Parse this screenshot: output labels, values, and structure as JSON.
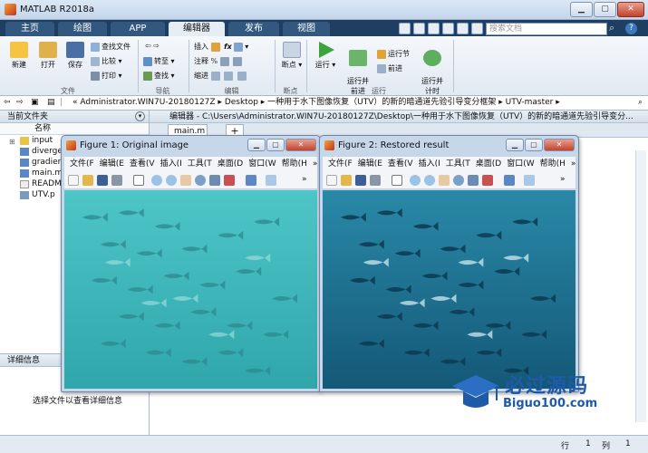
{
  "window": {
    "title": "MATLAB R2018a"
  },
  "ribbon_tabs": [
    {
      "label": "主页"
    },
    {
      "label": "绘图"
    },
    {
      "label": "APP"
    },
    {
      "label": "编辑器"
    },
    {
      "label": "发布"
    },
    {
      "label": "视图"
    }
  ],
  "search": {
    "placeholder": "搜索文档"
  },
  "ribbon": {
    "file": {
      "new": "新建",
      "open": "打开",
      "save": "保存",
      "find_files": "查找文件",
      "compare": "比较",
      "print": "打印",
      "group": "文件"
    },
    "navigate": {
      "goto": "转至",
      "find": "查找",
      "group": "导航"
    },
    "edit": {
      "insert": "插入",
      "comment": "注释",
      "indent": "缩进",
      "fx": "fx",
      "group": "编辑"
    },
    "breakpoints": {
      "label": "断点",
      "group": "断点"
    },
    "run": {
      "run": "运行",
      "run_advance": "运行并\n前进",
      "run_section": "运行节",
      "advance": "前进",
      "run_time": "运行并\n计时",
      "group": "运行"
    }
  },
  "address": {
    "path": "« Administrator.WIN7U-20180127Z  ▸  Desktop  ▸  一种用于水下图像恢复（UTV）的新的暗通道先验引导变分框架  ▸  UTV-master  ▸"
  },
  "current_folder": {
    "title": "当前文件夹",
    "column": "名称",
    "items": [
      "input",
      "diverge",
      "gradien",
      "main.m",
      "READM",
      "UTV.p"
    ]
  },
  "details": {
    "title": "详细信息",
    "hint": "选择文件以查看详细信息"
  },
  "editor": {
    "title": "编辑器 - C:\\Users\\Administrator.WIN7U-20180127Z\\Desktop\\一种用于水下图像恢复（UTV）的新的暗通道先验引导变分...",
    "tab": "main.m",
    "add_tab": "+"
  },
  "figure1": {
    "title": "Figure 1: Original image",
    "menu": [
      "文件(F",
      "编辑(E",
      "查看(V",
      "插入(I",
      "工具(T",
      "桌面(D",
      "窗口(W",
      "帮助(H"
    ],
    "more": "»"
  },
  "figure2": {
    "title": "Figure 2: Restored result",
    "menu": [
      "文件(F",
      "编辑(E",
      "查看(V",
      "插入(I",
      "工具(T",
      "桌面(D",
      "窗口(W",
      "帮助(H"
    ],
    "more": "»"
  },
  "status": {
    "row_label": "行",
    "row": "1",
    "col_label": "列",
    "col": "1"
  },
  "watermark": {
    "main": "必过源码",
    "sub": "Biguo100.com"
  },
  "colors": {
    "ribbon_dark": "#1e3e62",
    "orig_water": "#3fb7b8",
    "restored_water": "#1f6c8e"
  }
}
